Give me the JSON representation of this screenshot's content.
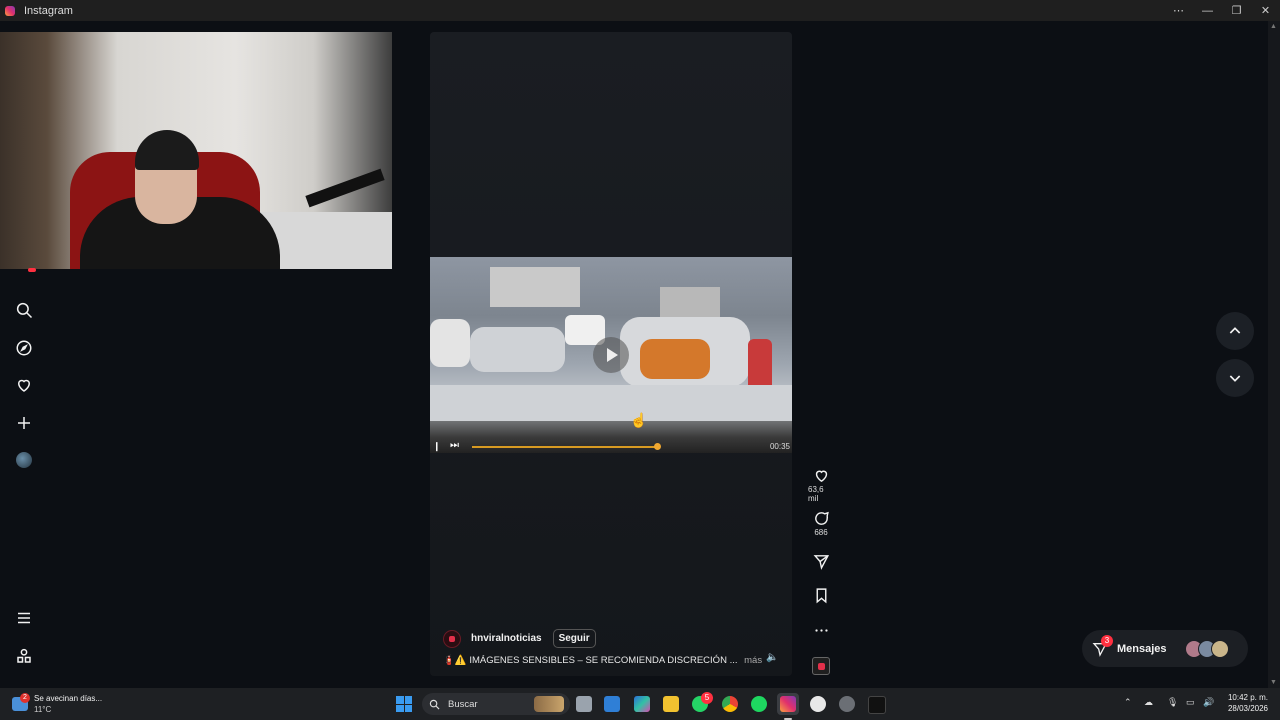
{
  "window": {
    "title": "Instagram",
    "controls": {
      "more": "⋯",
      "minimize": "—",
      "restore": "❐",
      "close": "✕"
    }
  },
  "reel": {
    "author": "hnviralnoticias",
    "follow_label": "Seguir",
    "caption": "IMÁGENES SENSIBLES – SE RECOMIENDA DISCRECIÓN ...",
    "caption_prefix": "🧯⚠️",
    "more_label": "más",
    "video": {
      "time": "00:35",
      "progress": 0.6
    }
  },
  "actions": {
    "likes": "63,6 mil",
    "comments": "686"
  },
  "messages": {
    "label": "Mensajes",
    "badge": "3"
  },
  "taskbar": {
    "weather_title": "Se avecinan días...",
    "weather_temp": "11°C",
    "weather_badge": "2",
    "search_placeholder": "Buscar",
    "whatsapp_badge": "5",
    "time": "10:42 p. m.",
    "date": "28/03/2026"
  },
  "colors": {
    "background": "#0c0f14",
    "accent_progress": "#f0a830",
    "badge_red": "#ff3040"
  }
}
